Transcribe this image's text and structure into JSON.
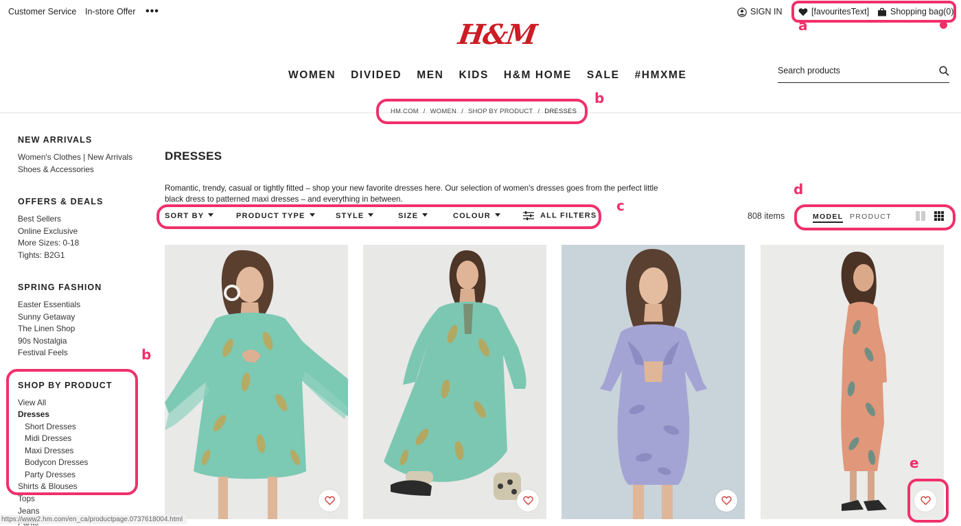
{
  "topbar": {
    "customer_service": "Customer Service",
    "instore_offer": "In-store Offer",
    "more": "•••",
    "sign_in": "SIGN IN",
    "favourites": "[favouritesText]",
    "shopping_bag": "Shopping bag(0)"
  },
  "logo": {
    "text": "H&M",
    "color": "#cc1c24"
  },
  "nav": [
    "WOMEN",
    "DIVIDED",
    "MEN",
    "KIDS",
    "H&M HOME",
    "SALE",
    "#HMXME"
  ],
  "search": {
    "placeholder": "Search products"
  },
  "breadcrumb": [
    "HM.COM",
    "WOMEN",
    "SHOP BY PRODUCT",
    "DRESSES"
  ],
  "breadcrumb_sep": "/",
  "sidebar": {
    "new_arrivals": {
      "title": "NEW ARRIVALS",
      "items": [
        "Women's Clothes | New Arrivals",
        "Shoes & Accessories"
      ]
    },
    "offers": {
      "title": "OFFERS & DEALS",
      "items": [
        "Best Sellers",
        "Online Exclusive",
        "More Sizes: 0-18",
        "Tights: B2G1"
      ]
    },
    "spring": {
      "title": "SPRING FASHION",
      "items": [
        "Easter Essentials",
        "Sunny Getaway",
        "The Linen Shop",
        "90s Nostalgia",
        "Festival Feels"
      ]
    },
    "shop_by_product": {
      "title": "SHOP BY PRODUCT",
      "view_all": "View All",
      "dresses": "Dresses",
      "sub": [
        "Short Dresses",
        "Midi Dresses",
        "Maxi Dresses",
        "Bodycon Dresses",
        "Party Dresses"
      ],
      "after": [
        "Shirts & Blouses",
        "Tops",
        "Jeans",
        "Pants"
      ]
    }
  },
  "content": {
    "title": "DRESSES",
    "description": "Romantic, trendy, casual or tightly fitted – shop your new favorite dresses here. Our selection of women's dresses goes from the perfect little black dress to patterned maxi dresses – and everything in between.",
    "filters": [
      "SORT BY",
      "PRODUCT TYPE",
      "STYLE",
      "SIZE",
      "COLOUR"
    ],
    "all_filters": "ALL FILTERS",
    "item_count": "808 items",
    "view_model": "MODEL",
    "view_product": "PRODUCT"
  },
  "annotations": [
    "a",
    "b",
    "b",
    "c",
    "d",
    "e"
  ],
  "status_url": "https://www2.hm.com/en_ca/productpage.0737618004.html",
  "colors": {
    "accent_annotation": "#f0306a",
    "brand_red": "#cc1c24"
  }
}
